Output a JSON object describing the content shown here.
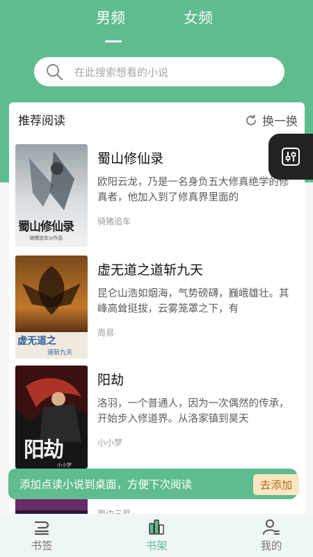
{
  "tabs": {
    "male": "男频",
    "female": "女频"
  },
  "search": {
    "placeholder": "在此搜索想看的小说"
  },
  "recommend": {
    "title": "推荐阅读",
    "refresh_label": "换一换"
  },
  "books": [
    {
      "title": "蜀山修仙录",
      "desc": "欧阳云龙，乃是一名身负五大修真绝学的修真者，他加入到了修真界里面的",
      "author": "骑猪追车",
      "cover_text": "蜀山修仙录",
      "cover_sub": "骑猪追车◎作品"
    },
    {
      "title": "虚无道之道斩九天",
      "desc": "昆仑山浩如烟海，气势磅礴，巍峨雄壮。其峰高耸挺拔，云雾笼罩之下，有",
      "author": "周易",
      "cover_text": "虚无道之",
      "cover_sub": "道斩九天"
    },
    {
      "title": "阳劫",
      "desc": "洛羽，一个普通人，因为一次偶然的传承，开始步入修道界。从洛家镇到昊天",
      "author": "小小梦",
      "cover_text": "阳劫",
      "cover_sub": "小小梦"
    },
    {
      "title": "",
      "desc": "",
      "author": "周边三易",
      "cover_text": "",
      "cover_sub": ""
    }
  ],
  "toast": {
    "text": "添加点读小说到桌面，方便下次阅读",
    "button": "去添加"
  },
  "nav": {
    "bookmark": "书签",
    "bookshelf": "书架",
    "mine": "我的"
  },
  "colors": {
    "brand": "#5fbc8e",
    "toast_button_bg": "#fbe7c2",
    "toast_button_text": "#b06b23"
  }
}
